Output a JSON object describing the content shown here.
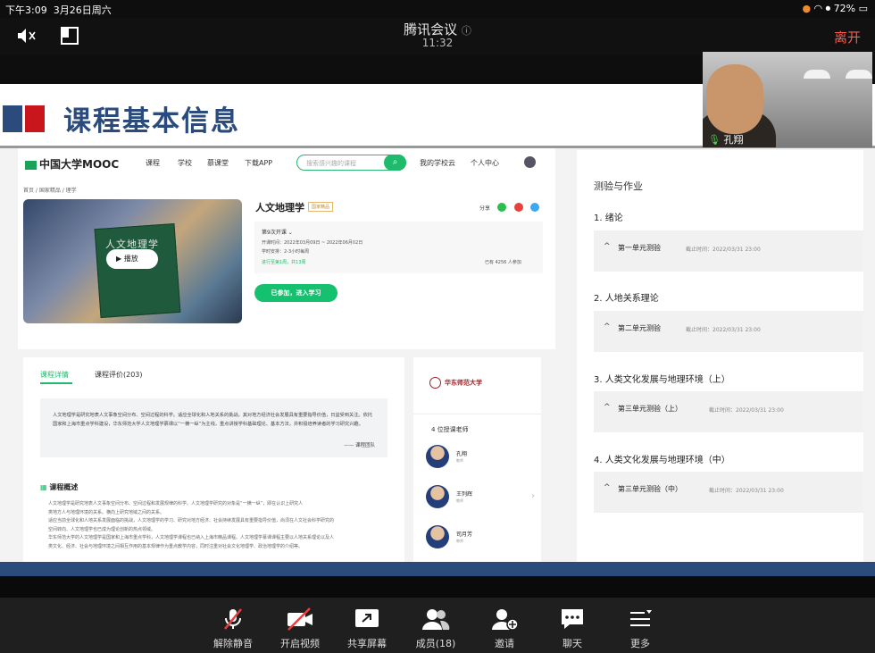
{
  "status_bar": {
    "time": "下午3:09",
    "date": "3月26日周六",
    "battery": "72%"
  },
  "meeting": {
    "title": "腾讯会议",
    "timer": "11:32",
    "leave": "离开",
    "info_icon": "ⓘ"
  },
  "slide": {
    "title": "课程基本信息"
  },
  "mooc": {
    "logo": "中国大学MOOC",
    "nav": [
      "课程",
      "学校",
      "慕课堂",
      "下载APP"
    ],
    "search_placeholder": "搜索感兴趣的课程",
    "nav_right": [
      "我的学校云",
      "个人中心"
    ],
    "breadcrumb": "首页 / 国家精品 / 理学",
    "thumb_title": "人文地理学",
    "play_label": "播放",
    "course_title": "人文地理学",
    "tag": "国家精品",
    "share_label": "分享",
    "session": "第9次开课",
    "dates": "开课时间：2022年03月09日 ~ 2022年06月02日",
    "hours": "学时安排：2-3小时每周",
    "progress": "进行至第1周，共13周",
    "enrolled": "已有 4256 人参加",
    "join_button": "已参加，进入学习",
    "tab_detail": "课程详情",
    "tab_reviews": "课程评价(203)",
    "quote": "人文地理学是研究地表人文事象空间分布、空间过程的科学。适应全球化和人地关系的挑战，其对地方经济社会发展具有重要指导价值，日益受到关注。依托国家和上海市重点学科建设，华东师范大学人文地理学慕课以“一横一纵”为主线，重点讲授学科基础理论、基本方法，并积极培养读者的学习研究兴趣。",
    "quote_source": "—— 课程团队",
    "overview_title": "课程概述",
    "overview_lines": [
      "人文地理学是研究地表人文事象空间分布、空间过程和发展规律的科学。人文地理学研究的对象是“一横一纵”，即在认识上研究人",
      "类地方人与地理环境的关系。横向上研究地域之间的关系。",
      "适应当前全球化和人地关系发展面临的挑战，人文地理学的学习、研究对地方经济、社会持续发展具有重要指导价值，尚须在人文社会科学研究的",
      "空间转向、人文地理学也已成为理论创新的热点领域。",
      "华东师范大学的人文地理学是国家和上海市重点学科，人文地理学课程也已纳入上海市精品课程。人文地理学慕课课程主要以人地关系理论以及人",
      "类文化、经济、社会与地理环境之间相互作用的基本规律作为重点教学内容，同时注重对社会文化地理学、政治地理学的介绍等。"
    ],
    "university": "华东师范大学",
    "teachers_heading": "4 位授课老师",
    "teachers": [
      {
        "name": "孔翔",
        "role": "教师"
      },
      {
        "name": "王列辉",
        "role": "教师"
      },
      {
        "name": "司月芳",
        "role": "教师"
      }
    ]
  },
  "quiz": {
    "heading": "测验与作业",
    "sections": [
      {
        "title": "1. 绪论",
        "quiz": "第一单元测验",
        "deadline": "截止时间：2022/03/31 23:00"
      },
      {
        "title": "2. 人地关系理论",
        "quiz": "第二单元测验",
        "deadline": "截止时间：2022/03/31 23:00"
      },
      {
        "title": "3. 人类文化发展与地理环境（上）",
        "quiz": "第三单元测验（上）",
        "deadline": "截止时间：2022/03/31 23:00"
      },
      {
        "title": "4. 人类文化发展与地理环境（中）",
        "quiz": "第三单元测验（中）",
        "deadline": "截止时间：2022/03/31 23:00"
      }
    ]
  },
  "camera": {
    "name": "孔翔"
  },
  "toolbar": {
    "unmute": "解除静音",
    "video": "开启视频",
    "share": "共享屏幕",
    "members": "成员(18)",
    "invite": "邀请",
    "chat": "聊天",
    "more": "更多"
  },
  "colors": {
    "accent_green": "#1fba6b",
    "slide_blue": "#2a4b7c",
    "slide_red": "#c9161d",
    "leave_red": "#ff5a4a"
  }
}
